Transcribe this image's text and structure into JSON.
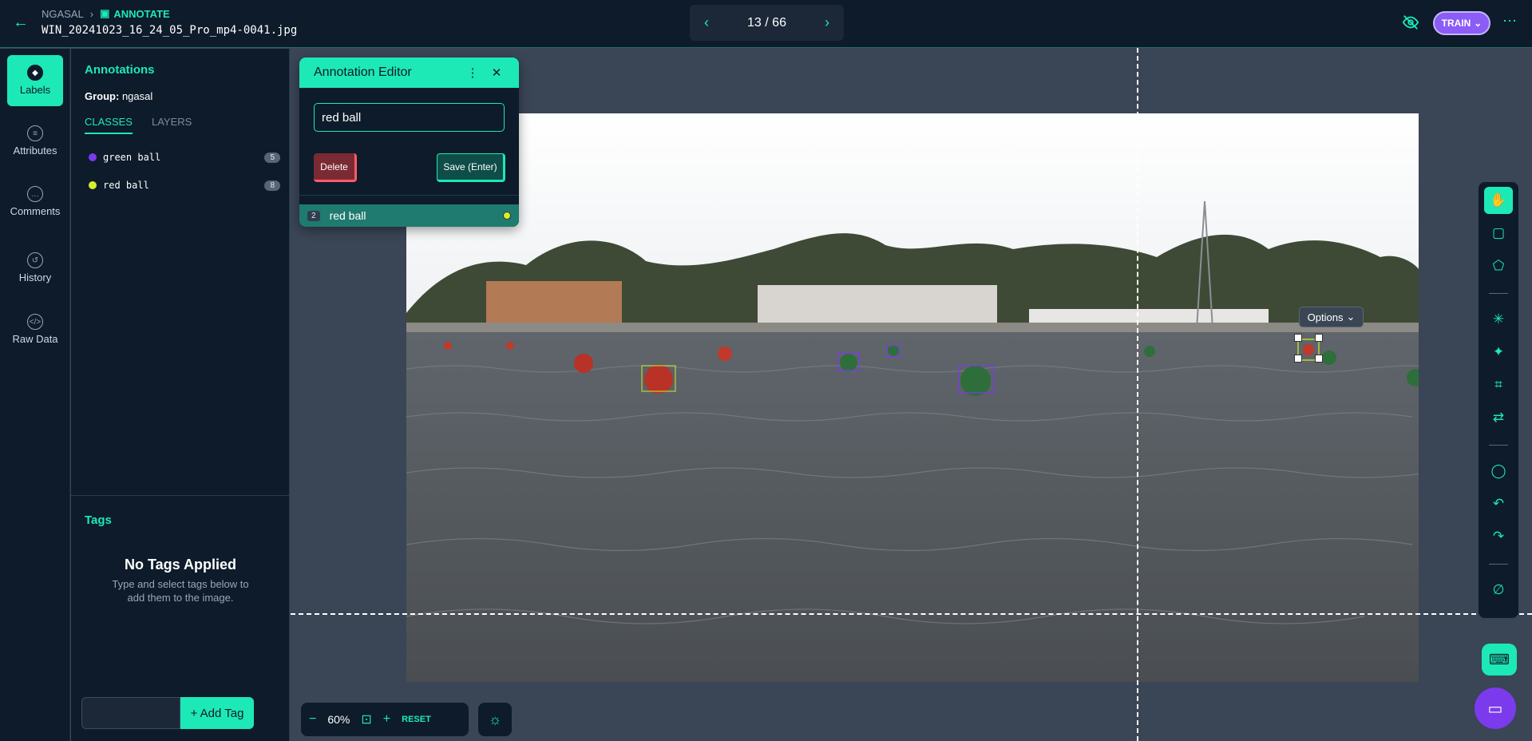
{
  "header": {
    "breadcrumb_parent": "NGASAL",
    "breadcrumb_current": "ANNOTATE",
    "filename": "WIN_20241023_16_24_05_Pro_mp4-0041.jpg",
    "pager_text": "13 / 66",
    "train_label": "TRAIN"
  },
  "rail": {
    "items": [
      {
        "label": "Labels",
        "icon": "tag-icon"
      },
      {
        "label": "Attributes",
        "icon": "list-icon"
      },
      {
        "label": "Comments",
        "icon": "comment-icon"
      },
      {
        "label": "History",
        "icon": "history-icon"
      },
      {
        "label": "Raw Data",
        "icon": "code-icon"
      }
    ]
  },
  "panel": {
    "title": "Annotations",
    "group_label": "Group:",
    "group_value": "ngasal",
    "tabs": [
      "CLASSES",
      "LAYERS"
    ],
    "classes": [
      {
        "name": "green ball",
        "count": "5",
        "color": "#7c3aed"
      },
      {
        "name": "red ball",
        "count": "8",
        "color": "#d4f02a"
      }
    ],
    "tags_title": "Tags",
    "no_tags_title": "No Tags Applied",
    "no_tags_sub": "Type and select tags below to add them to the image.",
    "add_tag_label": "+ Add Tag"
  },
  "editor": {
    "title": "Annotation Editor",
    "input_value": "red ball",
    "delete_label": "Delete",
    "save_label": "Save (Enter)",
    "row_index": "2",
    "row_label": "red ball"
  },
  "canvas": {
    "options_label": "Options"
  },
  "zoom": {
    "level": "60%",
    "reset_label": "RESET"
  },
  "colors": {
    "accent": "#1de9b6",
    "train": "#8b5cf6",
    "background": "#0d1b2a"
  }
}
